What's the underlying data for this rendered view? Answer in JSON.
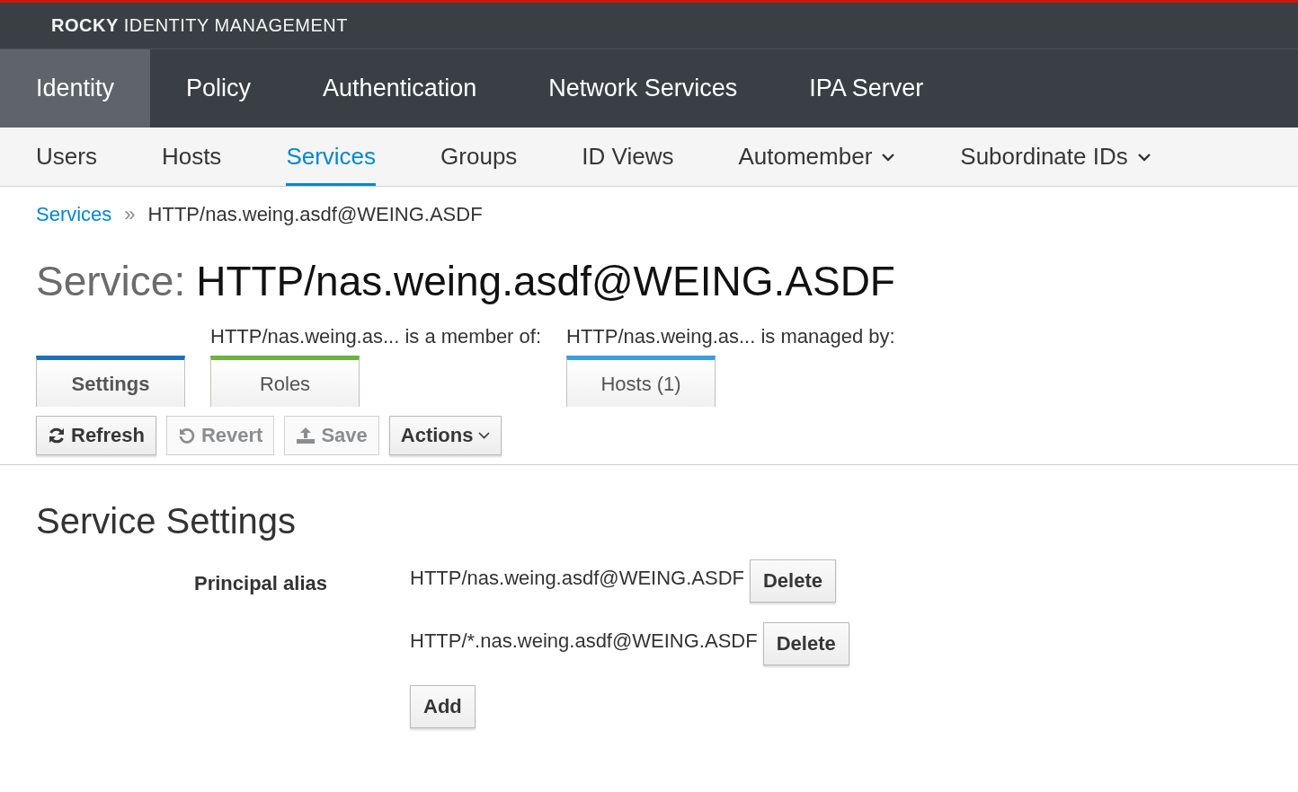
{
  "brand": "**ROCKY** IDENTITY MANAGEMENT",
  "nav": [
    {
      "label": "Identity",
      "selected": true
    },
    {
      "label": "Policy",
      "selected": false
    },
    {
      "label": "Authentication",
      "selected": false
    },
    {
      "label": "Network Services",
      "selected": false
    },
    {
      "label": "IPA Server",
      "selected": false
    }
  ],
  "subnav": [
    {
      "label": "Users",
      "selected": false,
      "dropdown": false
    },
    {
      "label": "Hosts",
      "selected": false,
      "dropdown": false
    },
    {
      "label": "Services",
      "selected": true,
      "dropdown": false
    },
    {
      "label": "Groups",
      "selected": false,
      "dropdown": false
    },
    {
      "label": "ID Views",
      "selected": false,
      "dropdown": false
    },
    {
      "label": "Automember",
      "selected": false,
      "dropdown": true
    },
    {
      "label": "Subordinate IDs",
      "selected": false,
      "dropdown": true
    }
  ],
  "breadcrumb": {
    "link": "Services",
    "separator": "»",
    "current": "HTTP/nas.weing.asdf@WEING.ASDF"
  },
  "title": {
    "prefix": "Service:",
    "name": "HTTP/nas.weing.asdf@WEING.ASDF"
  },
  "facet_groups": [
    {
      "tabs": [
        {
          "label": "Settings",
          "selected": true,
          "color": "#1f6fc0"
        }
      ]
    },
    {
      "heading": "HTTP/nas.weing.as... is a member of:",
      "tabs": [
        {
          "label": "Roles",
          "selected": false,
          "color": "#6cb33f"
        }
      ]
    },
    {
      "heading": "HTTP/nas.weing.as... is managed by:",
      "tabs": [
        {
          "label": "Hosts (1)",
          "selected": false,
          "color": "#3a9ee0"
        }
      ]
    }
  ],
  "actions": [
    {
      "kind": "refresh",
      "label": "Refresh",
      "disabled": false
    },
    {
      "kind": "revert",
      "label": "Revert",
      "disabled": true
    },
    {
      "kind": "save",
      "label": "Save",
      "disabled": true
    },
    {
      "kind": "dropdown",
      "label": "Actions",
      "disabled": false
    }
  ],
  "section": {
    "title": "Service Settings",
    "field_label": "Principal alias",
    "aliases": [
      {
        "value": "HTTP/nas.weing.asdf@WEING.ASDF",
        "button": "Delete"
      },
      {
        "value": "HTTP/*.nas.weing.asdf@WEING.ASDF",
        "button": "Delete"
      }
    ],
    "add_button": "Add"
  }
}
